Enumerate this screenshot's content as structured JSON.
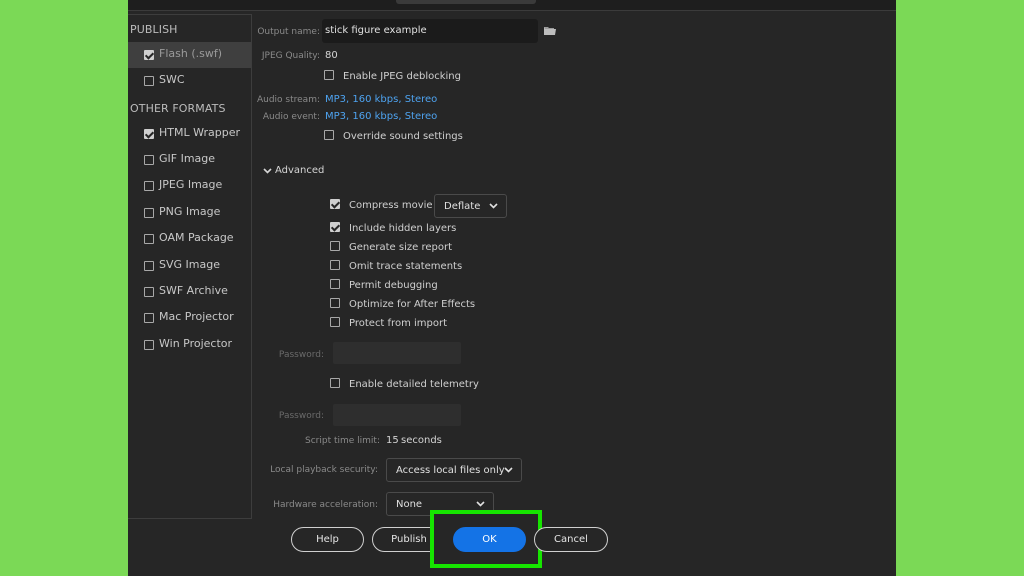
{
  "sidebar": {
    "publish_header": "PUBLISH",
    "other_header": "OTHER FORMATS",
    "publish_items": [
      {
        "label": "Flash (.swf)",
        "checked": true
      },
      {
        "label": "SWC",
        "checked": false
      }
    ],
    "other_items": [
      {
        "label": "HTML Wrapper",
        "checked": true
      },
      {
        "label": "GIF Image",
        "checked": false
      },
      {
        "label": "JPEG Image",
        "checked": false
      },
      {
        "label": "PNG Image",
        "checked": false
      },
      {
        "label": "OAM Package",
        "checked": false
      },
      {
        "label": "SVG Image",
        "checked": false
      },
      {
        "label": "SWF Archive",
        "checked": false
      },
      {
        "label": "Mac Projector",
        "checked": false
      },
      {
        "label": "Win Projector",
        "checked": false
      }
    ]
  },
  "settings": {
    "output_name_label": "Output name:",
    "output_name_value": "stick figure example",
    "jpeg_quality_label": "JPEG Quality:",
    "jpeg_quality_value": "80",
    "jpeg_deblocking_label": "Enable JPEG deblocking",
    "audio_stream_label": "Audio stream:",
    "audio_stream_value": "MP3, 160 kbps, Stereo",
    "audio_event_label": "Audio event:",
    "audio_event_value": "MP3, 160 kbps, Stereo",
    "override_sound_label": "Override sound settings"
  },
  "advanced": {
    "header": "Advanced",
    "compress_movie_label": "Compress movie",
    "compress_option": "Deflate",
    "options": [
      {
        "label": "Include hidden layers",
        "checked": true
      },
      {
        "label": "Generate size report",
        "checked": false
      },
      {
        "label": "Omit trace statements",
        "checked": false
      },
      {
        "label": "Permit debugging",
        "checked": false
      },
      {
        "label": "Optimize for After Effects",
        "checked": false
      },
      {
        "label": "Protect from import",
        "checked": false
      }
    ],
    "password_label": "Password:",
    "telemetry_label": "Enable detailed telemetry",
    "password2_label": "Password:",
    "script_time_label": "Script time limit:",
    "script_time_value": "15",
    "script_time_unit": "seconds",
    "local_playback_label": "Local playback security:",
    "local_playback_value": "Access local files only",
    "hw_accel_label": "Hardware acceleration:",
    "hw_accel_value": "None"
  },
  "buttons": {
    "help": "Help",
    "publish": "Publish",
    "ok": "OK",
    "cancel": "Cancel"
  },
  "colors": {
    "background": "#7bd956",
    "dialog": "#262626",
    "primary_button": "#1473e6",
    "link": "#4ea3f0",
    "highlight_box": "#16e500"
  },
  "icons": [
    "folder-icon",
    "chevron-down-icon",
    "checkbox-checked",
    "checkbox-unchecked"
  ]
}
